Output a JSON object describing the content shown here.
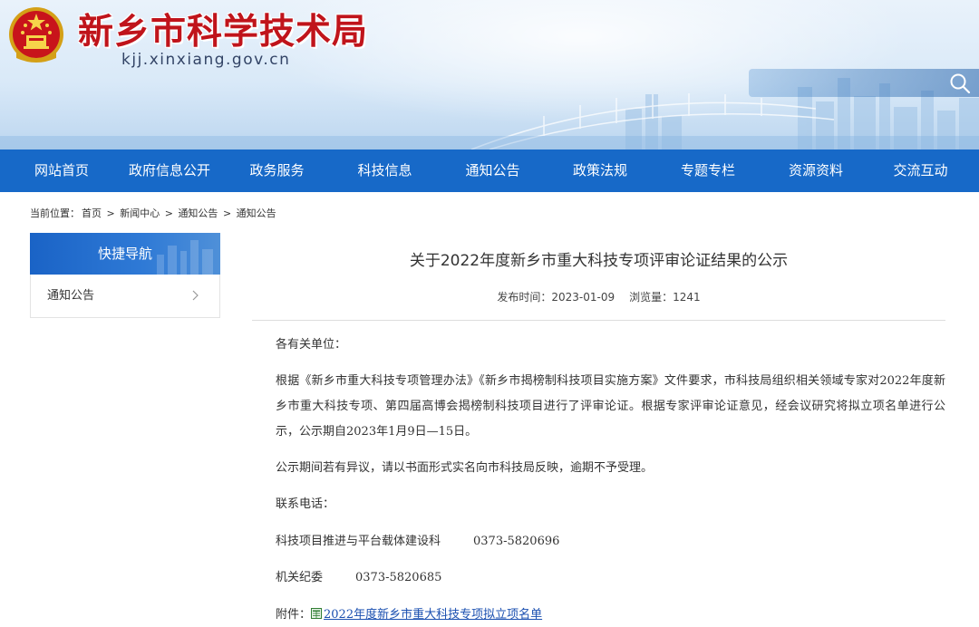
{
  "header": {
    "site_title": "新乡市科学技术局",
    "site_domain": "kjj.xinxiang.gov.cn",
    "search_placeholder": ""
  },
  "nav": {
    "items": [
      {
        "label": "网站首页"
      },
      {
        "label": "政府信息公开"
      },
      {
        "label": "政务服务"
      },
      {
        "label": "科技信息"
      },
      {
        "label": "通知公告"
      },
      {
        "label": "政策法规"
      },
      {
        "label": "专题专栏"
      },
      {
        "label": "资源资料"
      },
      {
        "label": "交流互动"
      }
    ]
  },
  "breadcrumb": {
    "prefix": "当前位置：",
    "items": [
      "首页",
      "新闻中心",
      "通知公告",
      "通知公告"
    ],
    "separator": ">"
  },
  "sidebar": {
    "heading": "快捷导航",
    "items": [
      {
        "label": "通知公告"
      }
    ]
  },
  "article": {
    "title": "关于2022年度新乡市重大科技专项评审论证结果的公示",
    "publish_label": "发布时间：",
    "publish_date": "2023-01-09",
    "views_label": "浏览量：",
    "views": "1241",
    "salutation": "各有关单位：",
    "para1": "根据《新乡市重大科技专项管理办法》《新乡市揭榜制科技项目实施方案》文件要求，市科技局组织相关领域专家对2022年度新乡市重大科技专项、第四届高博会揭榜制科技项目进行了评审论证。根据专家评审论证意见，经会议研究将拟立项名单进行公示，公示期自2023年1月9日—15日。",
    "para2": "公示期间若有异议，请以书面形式实名向市科技局反映，逾期不予受理。",
    "contact_label": "联系电话：",
    "contacts": [
      {
        "dept": "科技项目推进与平台载体建设科",
        "tel": "0373-5820696"
      },
      {
        "dept": "机关纪委",
        "tel": "0373-5820685"
      }
    ],
    "attachment_label": "附件：",
    "attachment_name": "2022年度新乡市重大科技专项拟立项名单"
  },
  "colors": {
    "brand_red": "#c0141b",
    "nav_blue": "#1769c8",
    "link_blue": "#1a4fb0"
  },
  "icons": {
    "search": "search-icon",
    "emblem": "national-emblem-icon",
    "chevron": "chevron-right-icon",
    "attachment": "spreadsheet-file-icon"
  }
}
